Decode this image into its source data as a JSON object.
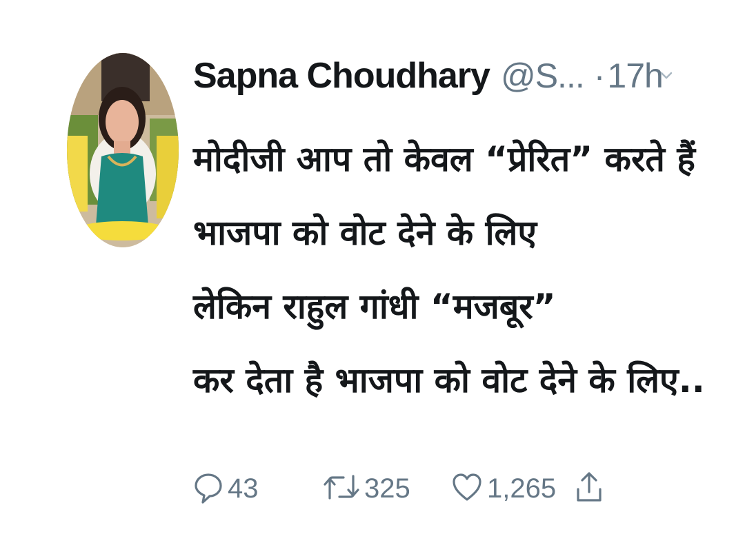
{
  "tweet": {
    "author": {
      "display_name": "Sapna Choudhary",
      "handle": "@S...",
      "separator": "·",
      "timestamp": "17h"
    },
    "lines": [
      "मोदीजी आप तो केवल “प्रेरित” करते हैं",
      "भाजपा को वोट देने के लिए",
      "लेकिन राहुल गांधी “मजबूर”",
      "कर देता है भाजपा को वोट देने के लिए.."
    ],
    "actions": {
      "reply_count": "43",
      "retweet_count": "325",
      "like_count": "1,265"
    },
    "icons": {
      "reply": "reply-icon",
      "retweet": "retweet-icon",
      "like": "heart-icon",
      "share": "share-icon",
      "more": "chevron-down-icon"
    },
    "colors": {
      "text": "#14171a",
      "muted": "#657786"
    }
  }
}
